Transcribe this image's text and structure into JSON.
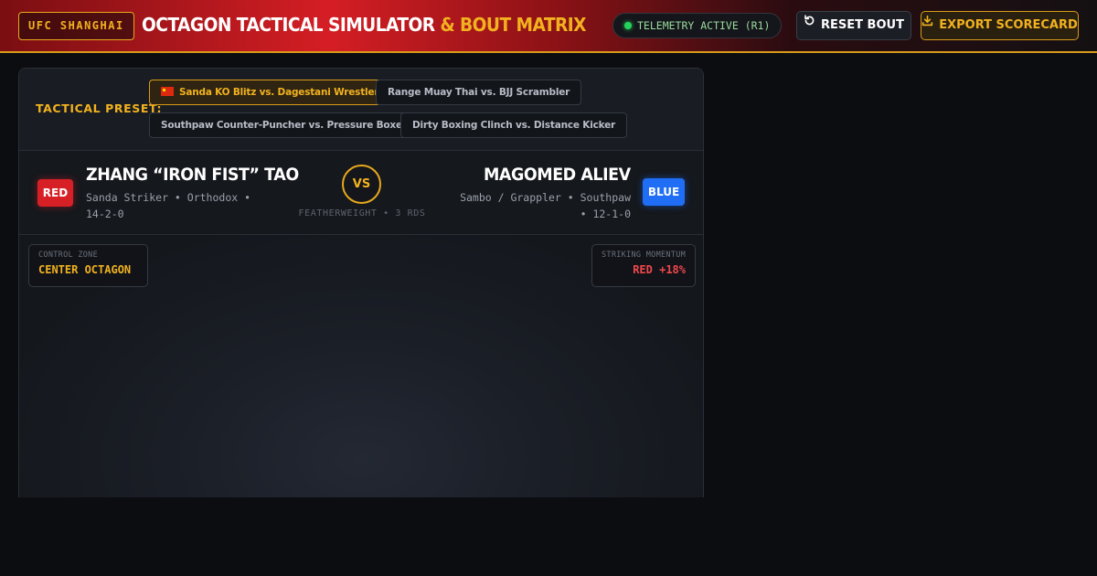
{
  "header": {
    "brand": "UFC SHANGHAI",
    "title_main": "OCTAGON TACTICAL SIMULATOR",
    "title_accent": "& BOUT MATRIX",
    "telemetry": "TELEMETRY ACTIVE (R1)",
    "reset_label": "RESET BOUT",
    "export_label": "EXPORT SCORECARD"
  },
  "presets": {
    "label": "TACTICAL PRESET:",
    "items": [
      {
        "label": "Sanda KO Blitz vs. Dagestani Wrestler",
        "active": true
      },
      {
        "label": "Range Muay Thai vs. BJJ Scrambler",
        "active": false
      },
      {
        "label": "Southpaw Counter-Puncher vs. Pressure Boxer",
        "active": false
      },
      {
        "label": "Dirty Boxing Clinch vs. Distance Kicker",
        "active": false
      }
    ]
  },
  "bout": {
    "red": {
      "corner": "RED",
      "name": "ZHANG “IRON FIST” TAO",
      "meta_line1": "Sanda Striker • Orthodox •",
      "meta_line2": "14-2-0"
    },
    "blue": {
      "corner": "BLUE",
      "name": "MAGOMED ALIEV",
      "meta_line1": "Sambo / Grappler • Southpaw",
      "meta_line2": "• 12-1-0"
    },
    "vs": "VS",
    "weight_class": "FEATHERWEIGHT • 3 RDS"
  },
  "arena": {
    "control_zone_label": "CONTROL ZONE",
    "control_zone_value": "CENTER OCTAGON",
    "momentum_label": "STRIKING MOMENTUM",
    "momentum_value": "RED +18%"
  },
  "colors": {
    "accent": "#f2b21f",
    "red_corner": "#d62026",
    "blue_corner": "#1f6ef5",
    "telemetry_dot": "#26d35a"
  }
}
